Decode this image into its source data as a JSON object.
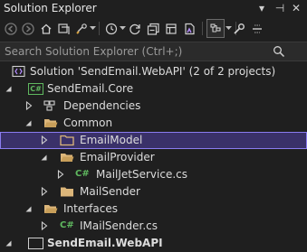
{
  "window": {
    "title": "Solution Explorer",
    "pin_glyph": "⊣",
    "close_glyph": "✕"
  },
  "toolbar": {
    "icons": [
      "back-icon",
      "forward-icon",
      "home-icon",
      "switch-views-icon",
      "pending-changes-icon",
      "history-icon",
      "sync-icon",
      "collapse-all-icon",
      "show-all-files-icon",
      "preview-icon",
      "properties-icon",
      "wrench-icon",
      "minus-icon"
    ]
  },
  "search": {
    "placeholder": "Search Solution Explorer (Ctrl+;)"
  },
  "tree": {
    "solution": "Solution 'SendEmail.WebAPI' (2 of 2 projects)",
    "project_core": "SendEmail.Core",
    "dependencies": "Dependencies",
    "folder_common": "Common",
    "folder_emailmodel": "EmailModel",
    "folder_emailprovider": "EmailProvider",
    "file_mailjet": "MailJetService.cs",
    "folder_mailsender": "MailSender",
    "folder_interfaces": "Interfaces",
    "file_imailsender": "IMailSender.cs",
    "project_webapi": "SendEmail.WebAPI",
    "csproj_badge": "C#",
    "cs_badge": "C#"
  },
  "colors": {
    "background": "#1f1f1f",
    "selection": "#3a3169",
    "selection_border": "#8a7cf0",
    "folder": "#dcb67a",
    "csharp": "#5fb85f"
  }
}
